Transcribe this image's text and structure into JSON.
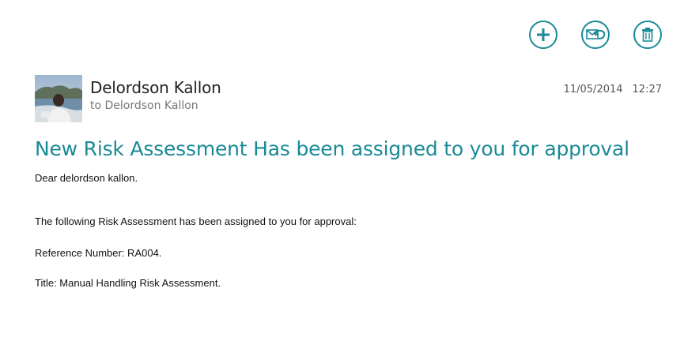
{
  "toolbar": {
    "new_icon": "plus-circle-icon",
    "reply_icon": "reply-envelope-icon",
    "delete_icon": "trash-icon",
    "accent_color": "#1a8a96"
  },
  "message": {
    "sender": "Delordson Kallon",
    "recipient": "to Delordson Kallon",
    "date": "11/05/2014",
    "time": "12:27",
    "subject": "New Risk Assessment Has been assigned to you for approval",
    "body": {
      "greeting": "Dear delordson kallon.",
      "intro": "The following Risk Assessment has been assigned to you for approval:",
      "reference": "Reference Number: RA004.",
      "title": "Title: Manual Handling Risk Assessment."
    }
  }
}
